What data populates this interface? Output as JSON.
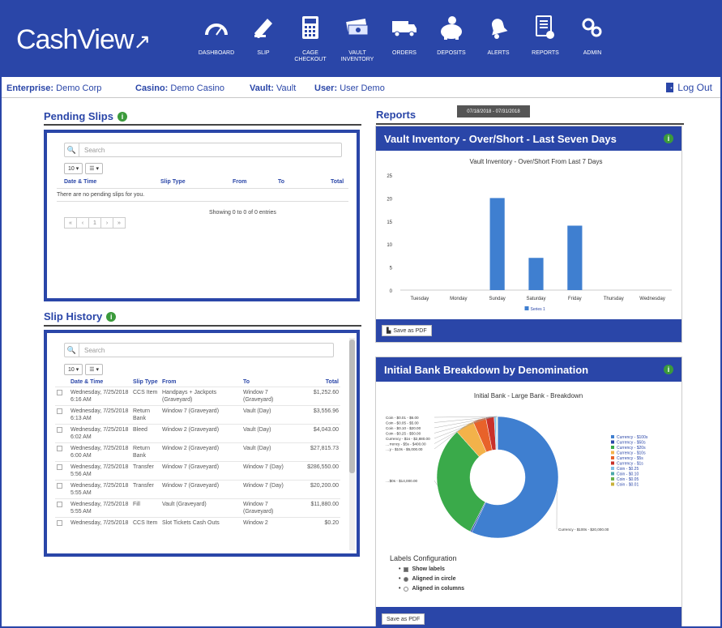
{
  "app": {
    "logo_text": "CashView"
  },
  "nav": [
    {
      "label": "DASHBOARD",
      "icon": "speedometer-icon"
    },
    {
      "label": "SLIP",
      "icon": "pencil-icon"
    },
    {
      "label": "CAGE CHECKOUT",
      "icon": "calculator-icon"
    },
    {
      "label": "VAULT INVENTORY",
      "icon": "money-stack-icon"
    },
    {
      "label": "ORDERS",
      "icon": "truck-icon"
    },
    {
      "label": "DEPOSITS",
      "icon": "piggy-bank-icon"
    },
    {
      "label": "ALERTS",
      "icon": "bell-icon"
    },
    {
      "label": "REPORTS",
      "icon": "report-icon"
    },
    {
      "label": "ADMIN",
      "icon": "gears-icon"
    }
  ],
  "infobar": {
    "enterprise_label": "Enterprise:",
    "enterprise_value": "Demo Corp",
    "casino_label": "Casino:",
    "casino_value": "Demo Casino",
    "vault_label": "Vault:",
    "vault_value": "Vault",
    "user_label": "User:",
    "user_value": "User Demo",
    "logout": "Log Out"
  },
  "pending": {
    "title": "Pending Slips",
    "search_placeholder": "Search",
    "page_size": "10",
    "columns": [
      "Date & Time",
      "Slip Type",
      "From",
      "To",
      "Total"
    ],
    "empty_message": "There are no pending slips for you.",
    "showing": "Showing 0 to 0 of 0 entries",
    "pager": [
      "«",
      "‹",
      "1",
      "›",
      "»"
    ]
  },
  "history": {
    "title": "Slip History",
    "search_placeholder": "Search",
    "page_size": "10",
    "columns": [
      "Date & Time",
      "Slip Type",
      "From",
      "To",
      "Total"
    ],
    "rows": [
      {
        "date": "Wednesday, 7/25/2018 6:16 AM",
        "type": "CCS Item",
        "from": "Handpays + Jackpots (Graveyard)",
        "to": "Window 7 (Graveyard)",
        "total": "$1,252.60"
      },
      {
        "date": "Wednesday, 7/25/2018 6:13 AM",
        "type": "Return Bank",
        "from": "Window 7 (Graveyard)",
        "to": "Vault (Day)",
        "total": "$3,556.96"
      },
      {
        "date": "Wednesday, 7/25/2018 6:02 AM",
        "type": "Bleed",
        "from": "Window 2 (Graveyard)",
        "to": "Vault (Day)",
        "total": "$4,043.00"
      },
      {
        "date": "Wednesday, 7/25/2018 6:00 AM",
        "type": "Return Bank",
        "from": "Window 2 (Graveyard)",
        "to": "Vault (Day)",
        "total": "$27,815.73"
      },
      {
        "date": "Wednesday, 7/25/2018 5:56 AM",
        "type": "Transfer",
        "from": "Window 7 (Graveyard)",
        "to": "Window 7 (Day)",
        "total": "$286,550.00"
      },
      {
        "date": "Wednesday, 7/25/2018 5:55 AM",
        "type": "Transfer",
        "from": "Window 7 (Graveyard)",
        "to": "Window 7 (Day)",
        "total": "$20,200.00"
      },
      {
        "date": "Wednesday, 7/25/2018 5:55 AM",
        "type": "Fill",
        "from": "Vault (Graveyard)",
        "to": "Window 7 (Graveyard)",
        "total": "$11,880.00"
      },
      {
        "date": "Wednesday, 7/25/2018",
        "type": "CCS Item",
        "from": "Slot Tickets Cash Outs",
        "to": "Window 2",
        "total": "$0.20"
      }
    ]
  },
  "reports": {
    "title": "Reports",
    "date_range": "07/18/2018 - 07/31/2018",
    "vault_panel_title": "Vault Inventory - Over/Short - Last Seven Days",
    "denom_panel_title": "Initial Bank Breakdown by Denomination",
    "save_pdf": "Save as PDF",
    "labels_config": {
      "title": "Labels Configuration",
      "options": [
        "Show labels",
        "Aligned in circle",
        "Aligned in columns"
      ]
    }
  },
  "chart_data": [
    {
      "type": "bar",
      "title": "Vault Inventory - Over/Short From Last 7 Days",
      "categories": [
        "Tuesday",
        "Monday",
        "Sunday",
        "Saturday",
        "Friday",
        "Thursday",
        "Wednesday"
      ],
      "series": [
        {
          "name": "Series 1",
          "values": [
            0,
            0,
            20,
            7,
            14,
            0,
            0
          ]
        }
      ],
      "ylim": [
        0,
        25
      ],
      "yticks": [
        0,
        5,
        10,
        15,
        20,
        25
      ],
      "colors": {
        "bar": "#3f7fd0"
      },
      "grid": false,
      "legend": "bottom"
    },
    {
      "type": "pie",
      "title": "Initial Bank - Large Bank - Breakdown",
      "labels": [
        "Currency - $100s",
        "Currency - $50s",
        "Currency - $20s",
        "Currency - $10s",
        "Currency - $5s",
        "Currency - $1s",
        "Coin - $0.25",
        "Coin - $0.10",
        "Coin - $0.05",
        "Coin - $0.01"
      ],
      "values": [
        57,
        0.4,
        31,
        5,
        3.5,
        2.2,
        0.5,
        0.2,
        0.1,
        0.1
      ],
      "slice_labels": [
        "Currency - $100s - $20,000.00",
        "",
        "…$0s - $14,000.00",
        "…y - $10s - $5,000.00",
        "…rrency - $5s - $400.00",
        "Currency - $1s - $2,880.00",
        "Coin - $0.25 - $50.00",
        "Coin - $0.10 - $20.00",
        "Coin - $0.05 - $5.00",
        "Coin - $0.01 - $6.00"
      ],
      "colors": [
        "#3f7fd0",
        "#2a46a8",
        "#3aaa4a",
        "#f3b24a",
        "#e8622a",
        "#c8312a",
        "#7fbfe8",
        "#4aa8a8",
        "#6ab04a",
        "#c8b03a"
      ],
      "donut": true,
      "legend": "right"
    }
  ]
}
